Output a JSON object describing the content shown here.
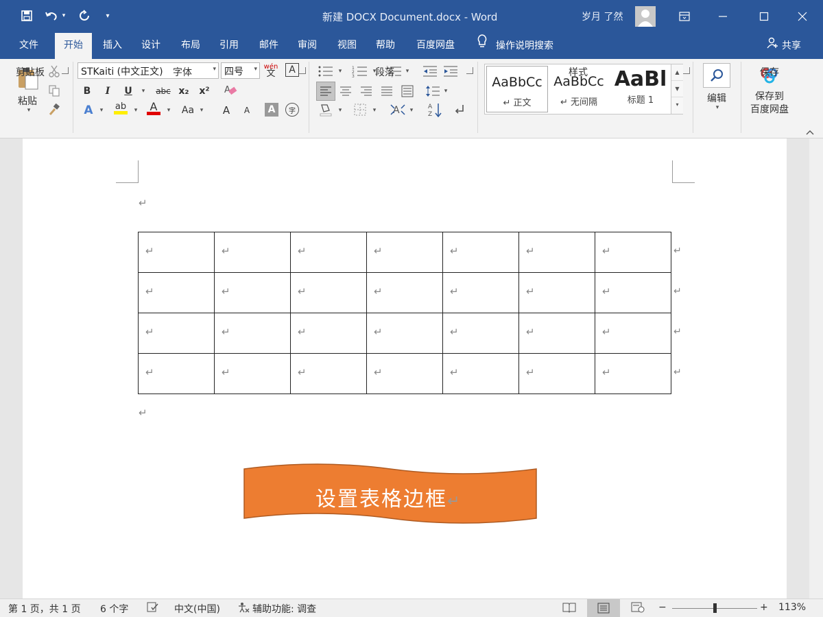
{
  "window": {
    "title": "新建 DOCX Document.docx  -  Word",
    "user": "岁月 了然"
  },
  "tabs": [
    "文件",
    "开始",
    "插入",
    "设计",
    "布局",
    "引用",
    "邮件",
    "审阅",
    "视图",
    "帮助",
    "百度网盘"
  ],
  "active_tab": "开始",
  "tell_me": "操作说明搜索",
  "share": "共享",
  "ribbon": {
    "clipboard": {
      "paste": "粘贴",
      "label": "剪贴板"
    },
    "font": {
      "name": "STKaiti (中文正文)",
      "size": "四号",
      "label": "字体",
      "bold": "B",
      "italic": "I",
      "underline": "U",
      "strike": "abc",
      "subscript": "x₂",
      "superscript": "x²",
      "text_effect": "A",
      "highlight": "ab",
      "font_color": "A",
      "change_case": "Aa",
      "grow": "A",
      "shrink": "A",
      "char_shade": "A",
      "enclose": "字",
      "phonetic": "wén",
      "border_char": "A"
    },
    "paragraph": {
      "label": "段落"
    },
    "styles": {
      "label": "样式",
      "items": [
        {
          "sample": "AaBbCc",
          "name": "↵ 正文"
        },
        {
          "sample": "AaBbCc",
          "name": "↵ 无间隔"
        },
        {
          "sample": "AaBl",
          "name": "标题 1"
        }
      ]
    },
    "editing": {
      "label": "编辑"
    },
    "save": {
      "button": "保存到百度网盘",
      "line1": "保存到",
      "line2": "百度网盘",
      "label": "保存"
    }
  },
  "document": {
    "paragraph_mark": "↵",
    "table": {
      "rows": 4,
      "cols": 7,
      "cell_text": "↵"
    },
    "banner_text": "设置表格边框"
  },
  "statusbar": {
    "page": "第 1 页，共 1 页",
    "words": "6 个字",
    "language": "中文(中国)",
    "accessibility": "辅助功能: 调查",
    "zoom_minus": "−",
    "zoom_plus": "+",
    "zoom": "113%"
  },
  "colors": {
    "title_bar": "#2b579a",
    "banner_fill": "#ed7d31",
    "banner_stroke": "#ae5a21"
  }
}
